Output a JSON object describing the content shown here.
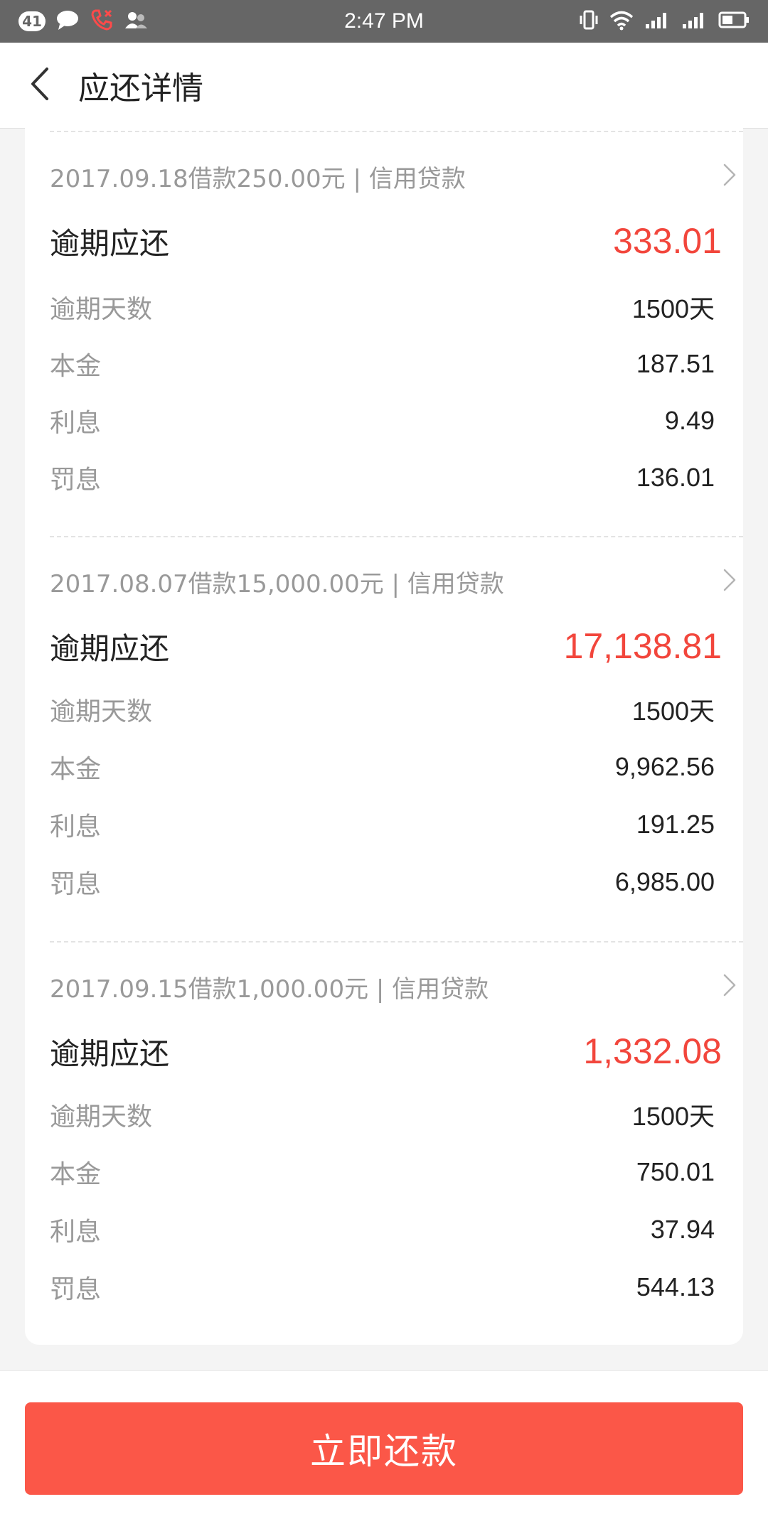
{
  "status_bar": {
    "notification_count": "41",
    "time": "2:47 PM",
    "icons_left": [
      "notification-count-badge",
      "chat-bubble-icon",
      "missed-call-icon",
      "contacts-icon"
    ],
    "icons_right": [
      "vibrate-icon",
      "wifi-icon",
      "signal-icon",
      "signal-2-icon",
      "battery-icon"
    ]
  },
  "nav": {
    "title": "应还详情",
    "back_icon": "chevron-left-icon"
  },
  "loans": [
    {
      "header": "2017.09.18借款250.00元 | 信用贷款",
      "overdue_label": "逾期应还",
      "overdue_amount": "333.01",
      "details": [
        {
          "label": "逾期天数",
          "value": "1500天"
        },
        {
          "label": "本金",
          "value": "187.51"
        },
        {
          "label": "利息",
          "value": "9.49"
        },
        {
          "label": "罚息",
          "value": "136.01"
        }
      ]
    },
    {
      "header": "2017.08.07借款15,000.00元 | 信用贷款",
      "overdue_label": "逾期应还",
      "overdue_amount": "17,138.81",
      "details": [
        {
          "label": "逾期天数",
          "value": "1500天"
        },
        {
          "label": "本金",
          "value": "9,962.56"
        },
        {
          "label": "利息",
          "value": "191.25"
        },
        {
          "label": "罚息",
          "value": "6,985.00"
        }
      ]
    },
    {
      "header": "2017.09.15借款1,000.00元 | 信用贷款",
      "overdue_label": "逾期应还",
      "overdue_amount": "1,332.08",
      "details": [
        {
          "label": "逾期天数",
          "value": "1500天"
        },
        {
          "label": "本金",
          "value": "750.01"
        },
        {
          "label": "利息",
          "value": "37.94"
        },
        {
          "label": "罚息",
          "value": "544.13"
        }
      ]
    }
  ],
  "footer": {
    "pay_button_label": "立即还款"
  },
  "colors": {
    "accent_red": "#f2463c",
    "button_red": "#fb5748",
    "status_bar_gray": "#666666",
    "label_gray": "#999999",
    "text_dark": "#222222",
    "page_background": "#f4f4f4"
  }
}
